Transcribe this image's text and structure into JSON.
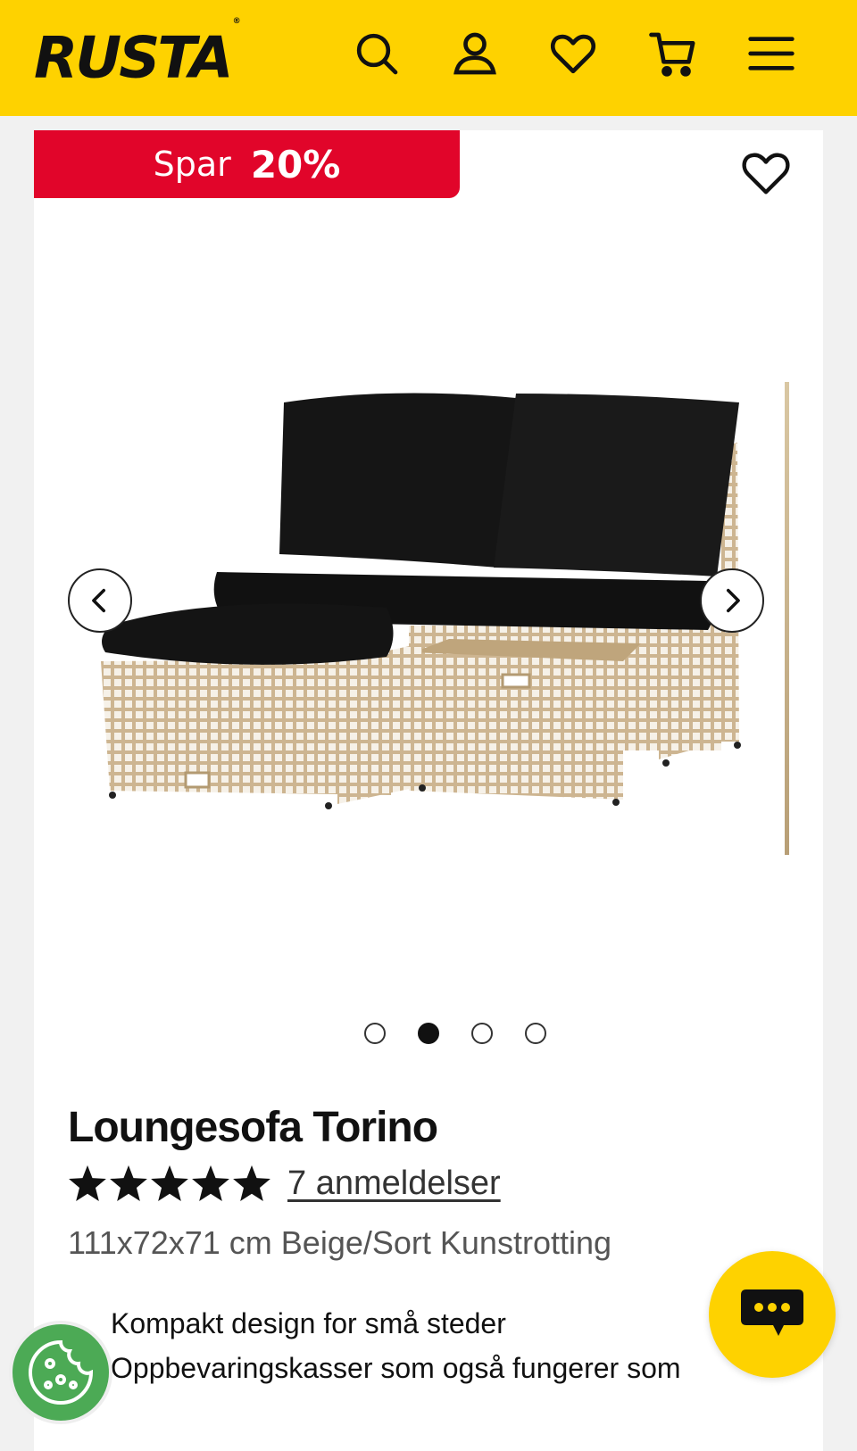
{
  "header": {
    "logo": "RUSTA",
    "logo_mark": "®",
    "icons": [
      "search-icon",
      "account-icon",
      "wishlist-icon",
      "cart-icon",
      "menu-icon"
    ]
  },
  "product": {
    "badge_prefix": "Spar",
    "badge_value": "20%",
    "title": "Loungesofa Torino",
    "rating": 5,
    "reviews": "7 anmeldelser",
    "specs": "111x72x71 cm Beige/Sort Kunstrotting",
    "features": [
      "Kompakt design for små steder",
      "Oppbevaringskasser som også fungerer som"
    ]
  },
  "carousel": {
    "dot_count": 4,
    "active_index": 1
  },
  "colors": {
    "brand_yellow": "#fed200",
    "sale_red": "#e1052a",
    "cookie_green": "#4caa55"
  }
}
